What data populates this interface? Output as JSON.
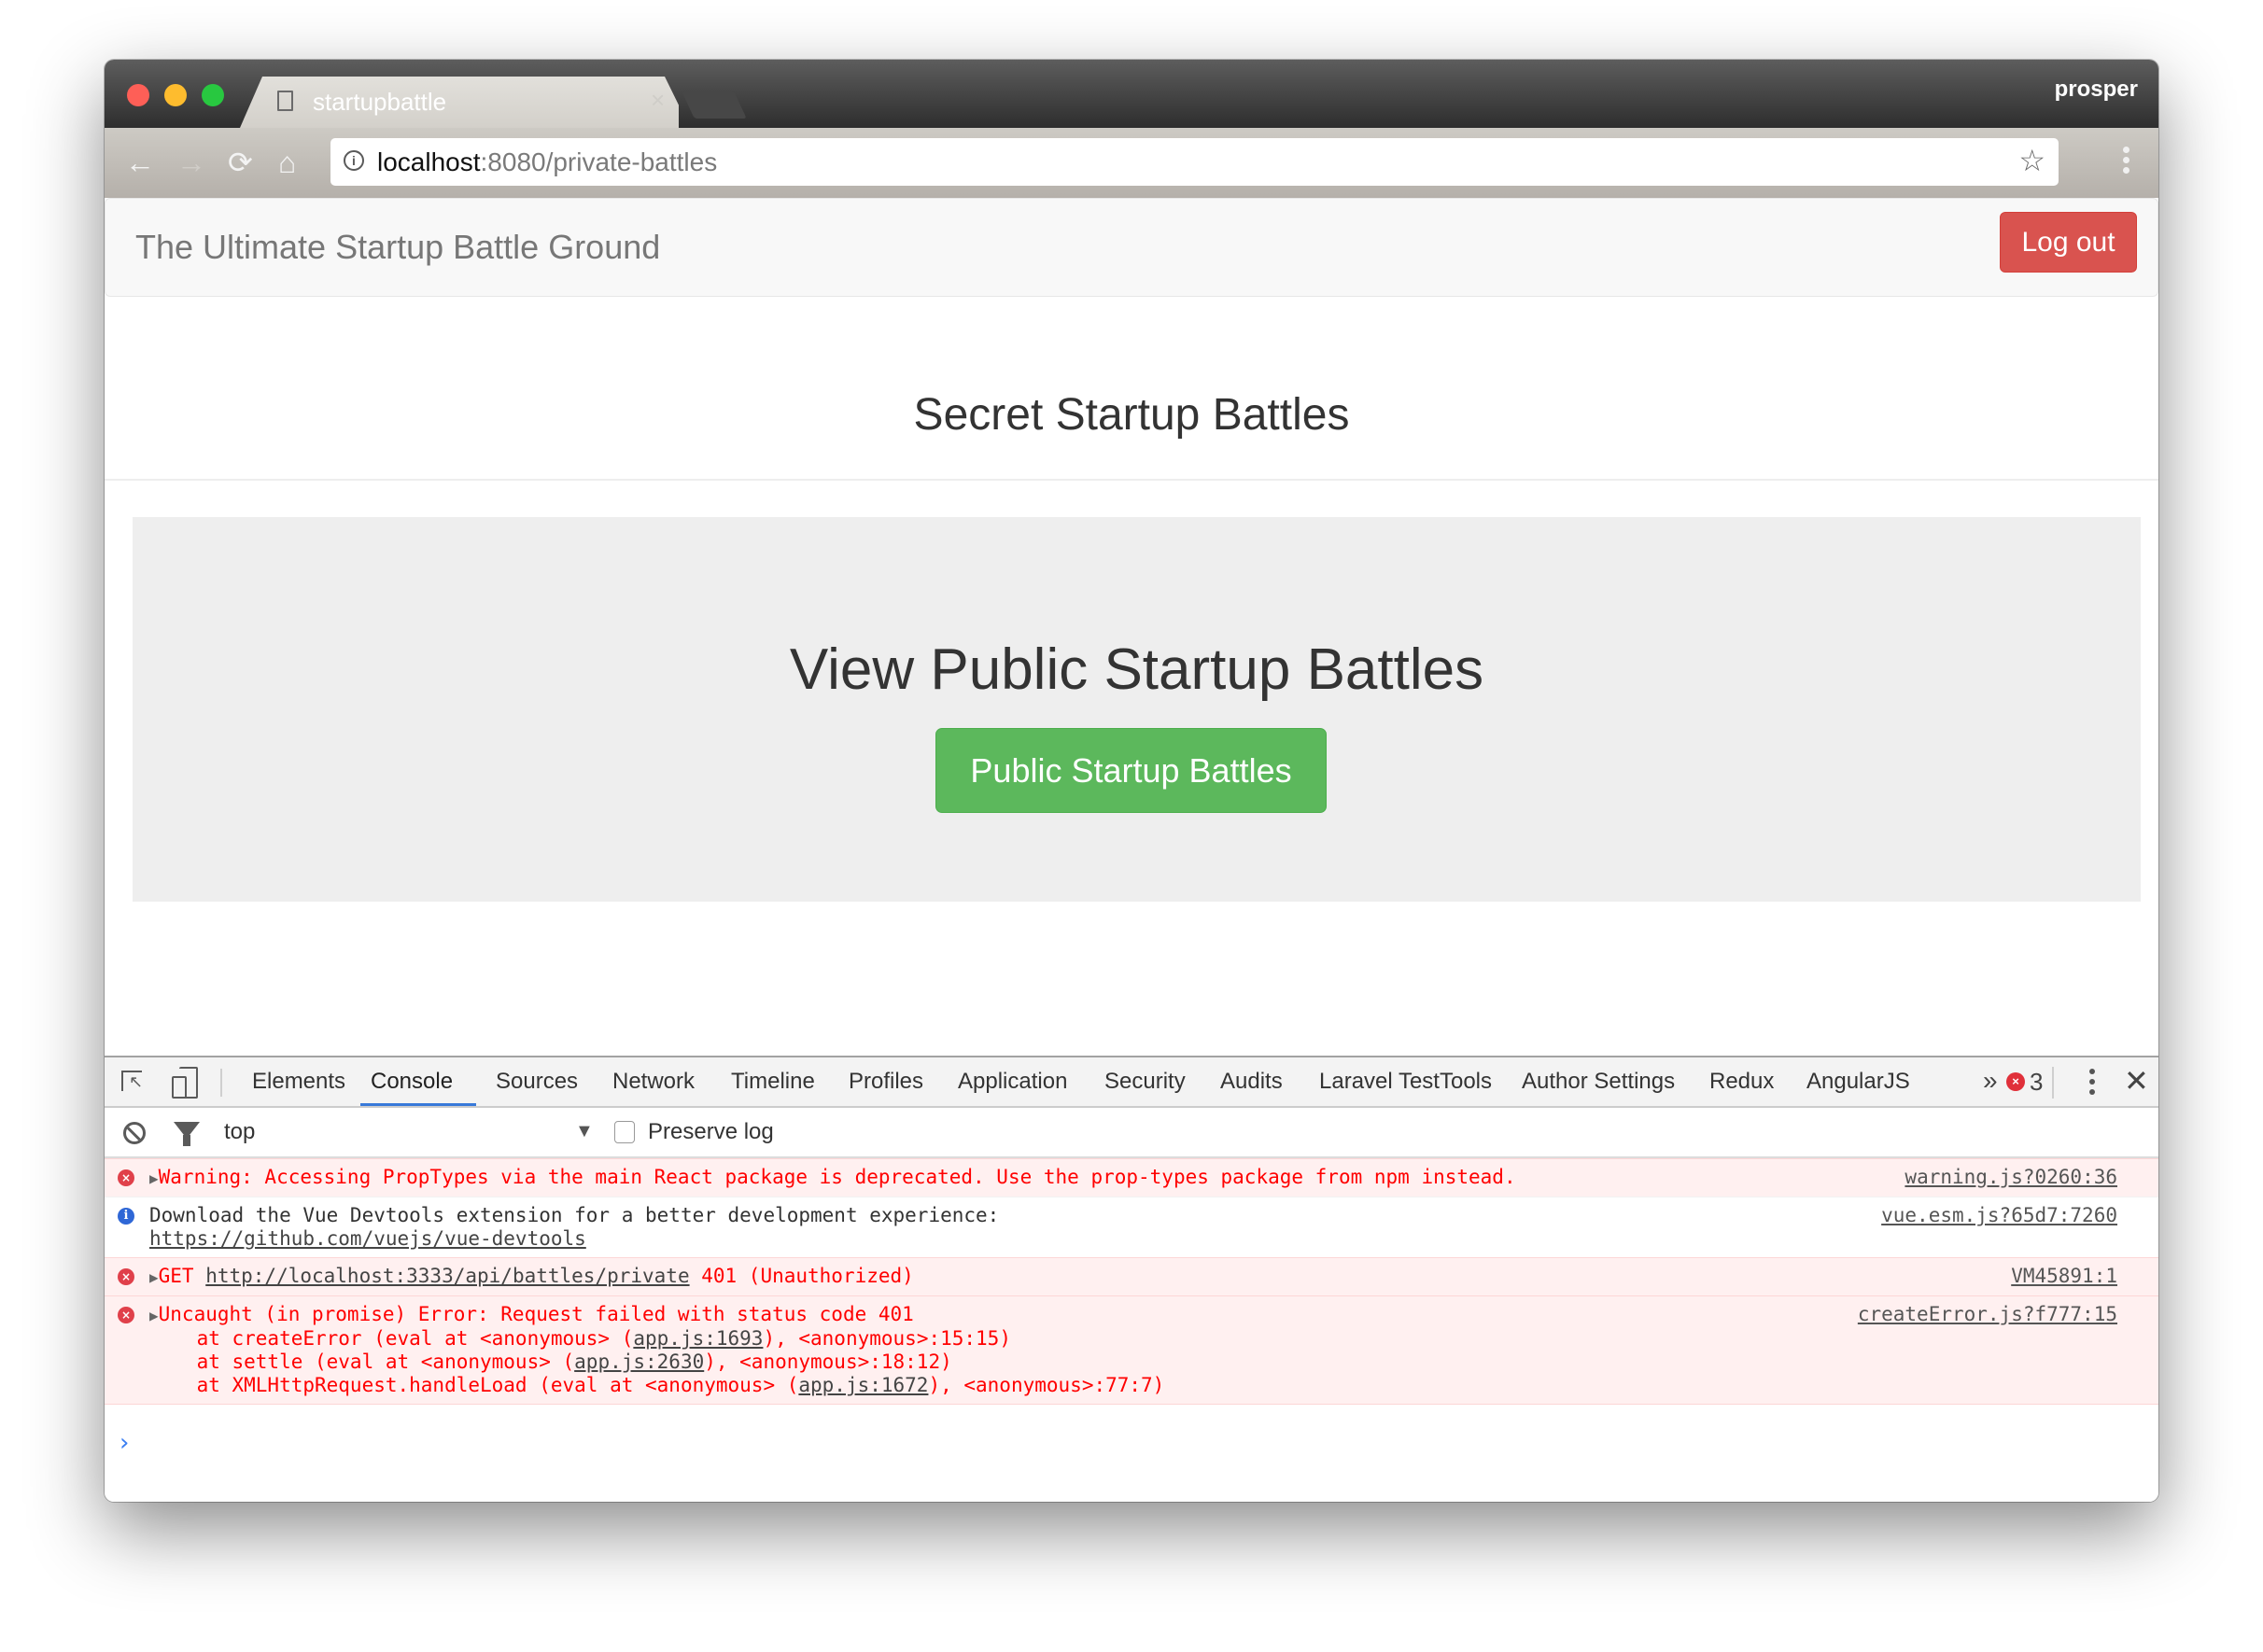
{
  "browser": {
    "tab_title": "startupbattle",
    "tab_close": "×",
    "profile_name": "prosper",
    "url_host": "localhost",
    "url_rest": ":8080/private-battles",
    "info_glyph": "i",
    "star_glyph": "☆",
    "back_glyph": "←",
    "forward_glyph": "→",
    "reload_glyph": "⟳",
    "home_glyph": "⌂"
  },
  "page": {
    "brand": "The Ultimate Startup Battle Ground",
    "logout_label": "Log out",
    "title": "Secret Startup Battles",
    "jumbotron_heading": "View Public Startup Battles",
    "jumbotron_button": "Public Startup Battles",
    "colors": {
      "danger": "#d9534f",
      "success": "#5cb85c",
      "jumbotron_bg": "#eeeeee"
    }
  },
  "devtools": {
    "tabs": [
      "Elements",
      "Console",
      "Sources",
      "Network",
      "Timeline",
      "Profiles",
      "Application",
      "Security",
      "Audits",
      "Laravel TestTools",
      "Author Settings",
      "Redux",
      "AngularJS"
    ],
    "active_tab": "Console",
    "more_glyph": "»",
    "error_count": "3",
    "close_glyph": "✕",
    "context": "top",
    "context_arrow": "▼",
    "preserve_log_label": "Preserve log",
    "preserve_log_checked": false,
    "messages": [
      {
        "level": "error",
        "text": "Warning: Accessing PropTypes via the main React package is deprecated. Use the prop-types package from npm instead.",
        "source": "warning.js?0260:36"
      },
      {
        "level": "info",
        "text": "Download the Vue Devtools extension for a better development experience:",
        "link": "https://github.com/vuejs/vue-devtools",
        "source": "vue.esm.js?65d7:7260"
      },
      {
        "level": "error",
        "prefix": "GET ",
        "link": "http://localhost:3333/api/battles/private",
        "suffix": " 401 (Unauthorized)",
        "source": "VM45891:1"
      },
      {
        "level": "error",
        "text": "Uncaught (in promise) Error: Request failed with status code 401",
        "source": "createError.js?f777:15",
        "stack": [
          {
            "pre": "    at createError (eval at <anonymous> (",
            "link": "app.js:1693",
            "post": "), <anonymous>:15:15)"
          },
          {
            "pre": "    at settle (eval at <anonymous> (",
            "link": "app.js:2630",
            "post": "), <anonymous>:18:12)"
          },
          {
            "pre": "    at XMLHttpRequest.handleLoad (eval at <anonymous> (",
            "link": "app.js:1672",
            "post": "), <anonymous>:77:7)"
          }
        ]
      }
    ],
    "prompt_glyph": "›"
  }
}
